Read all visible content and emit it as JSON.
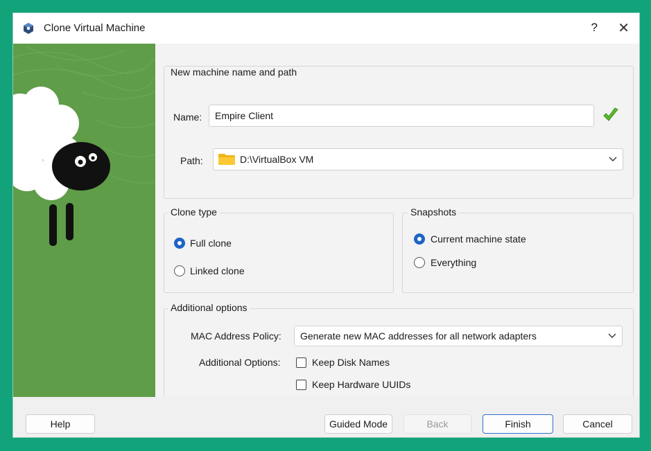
{
  "window": {
    "title": "Clone Virtual Machine",
    "help_symbol": "?",
    "close_symbol": "✕"
  },
  "name_path": {
    "group_title": "New machine name and path",
    "name_label": "Name:",
    "name_value": "Empire Client",
    "path_label": "Path:",
    "path_value": "D:\\VirtualBox VM"
  },
  "clone_type": {
    "group_title": "Clone type",
    "options": [
      {
        "label": "Full clone",
        "selected": true
      },
      {
        "label": "Linked clone",
        "selected": false
      }
    ]
  },
  "snapshots": {
    "group_title": "Snapshots",
    "options": [
      {
        "label": "Current machine state",
        "selected": true
      },
      {
        "label": "Everything",
        "selected": false
      }
    ]
  },
  "additional": {
    "group_title": "Additional options",
    "mac_label": "MAC Address Policy:",
    "mac_value": "Generate new MAC addresses for all network adapters",
    "options_label": "Additional Options:",
    "keep_disk_names": "Keep Disk Names",
    "keep_hw_uuids": "Keep Hardware UUIDs"
  },
  "buttons": {
    "help": "Help",
    "guided": "Guided Mode",
    "back": "Back",
    "finish": "Finish",
    "cancel": "Cancel"
  },
  "colors": {
    "accent": "#1f63c6",
    "art_green": "#5f9d49",
    "valid_check": "#5cb82e"
  }
}
